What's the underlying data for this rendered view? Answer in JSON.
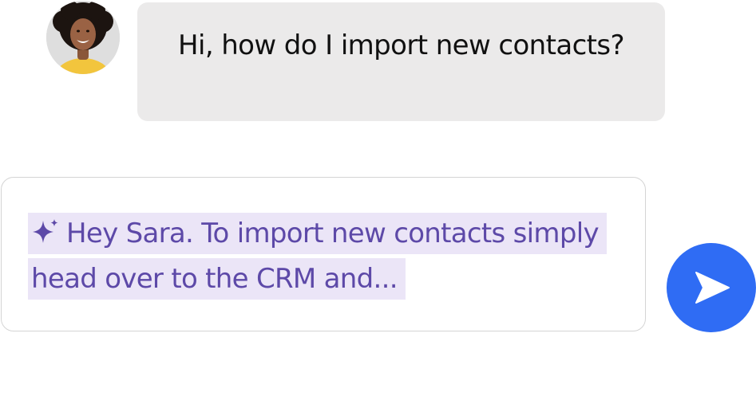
{
  "conversation": {
    "user_message": "Hi, how do I import new contacts?",
    "ai_draft": "Hey Sara. To import new contacts simply head over to the CRM and..."
  },
  "icons": {
    "sparkle": "sparkle-icon",
    "send": "send-icon"
  },
  "colors": {
    "user_bubble": "#ebeaea",
    "draft_text": "#5d49a8",
    "draft_highlight": "#ebe5f7",
    "send_button": "#2f6cf4"
  }
}
